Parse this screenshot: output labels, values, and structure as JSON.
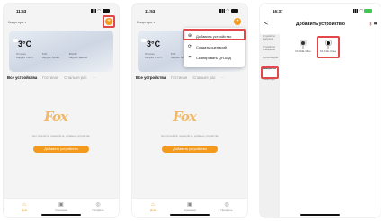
{
  "phone1": {
    "time": "11:53",
    "home_name": "Квартира ▾",
    "plus": "+",
    "weather": {
      "temp": "3°C",
      "col1": [
        "Отлично",
        "Наружн. PM2.5"
      ],
      "col2": [
        "51%",
        "Наружн. Влажн."
      ],
      "col3": [
        "99Lb/Кт",
        "Наружн. Давлен."
      ]
    },
    "tabs": {
      "all": "Все устройства",
      "living": "Гостиная",
      "bedroom": "Спальня рас",
      "more": "···"
    },
    "fox": "Fox",
    "empty": "Нет устройств, пожалуйста, добавьте устройство",
    "add_button": "Добавить устройство",
    "nav": [
      {
        "label": "Дом",
        "icon": "⌂"
      },
      {
        "label": "Сценарии",
        "icon": "▣"
      },
      {
        "label": "Профиль",
        "icon": "◎"
      }
    ]
  },
  "phone2": {
    "time": "11:53",
    "home_name": "Квартира ▾",
    "plus": "+",
    "weather": {
      "temp": "3°C",
      "col1": [
        "Отлично",
        "Наружн. PM2.5"
      ],
      "col2": [
        "51%",
        "Наружн. Влажн."
      ]
    },
    "tabs": {
      "all": "Все устройства",
      "living": "Гостиная",
      "bedroom": "Спальня рас",
      "more": "···"
    },
    "menu": [
      {
        "icon": "⊕",
        "label": "Добавить устройство"
      },
      {
        "icon": "⟳",
        "label": "Создать сценарий"
      },
      {
        "icon": "⌗",
        "label": "Сканировать QR-код"
      }
    ],
    "fox": "Fox",
    "empty": "Нет устройств, пожалуйста, добавьте устройство",
    "add_button": "Добавить устройство",
    "nav": [
      {
        "label": "Дом",
        "icon": "⌂"
      },
      {
        "label": "Сценарии",
        "icon": "▣"
      },
      {
        "label": "Профиль",
        "icon": "◎"
      }
    ]
  },
  "phone3": {
    "time": "16:37",
    "title": "Добавить устройство",
    "back": "<",
    "icons": {
      "bluetooth": "ᛒ",
      "scan": "⌗"
    },
    "categories": [
      "Устройство контроля",
      "Устройство освещения",
      "Мультимедиа",
      "Камеры 4G",
      "Умный дом"
    ],
    "selected_category": 3,
    "devices": [
      {
        "name": "FX-C10E, Мини"
      },
      {
        "name": "FX-C10E, Улица"
      }
    ]
  },
  "colors": {
    "accent": "#f39a1c",
    "highlight": "#e2474b"
  }
}
